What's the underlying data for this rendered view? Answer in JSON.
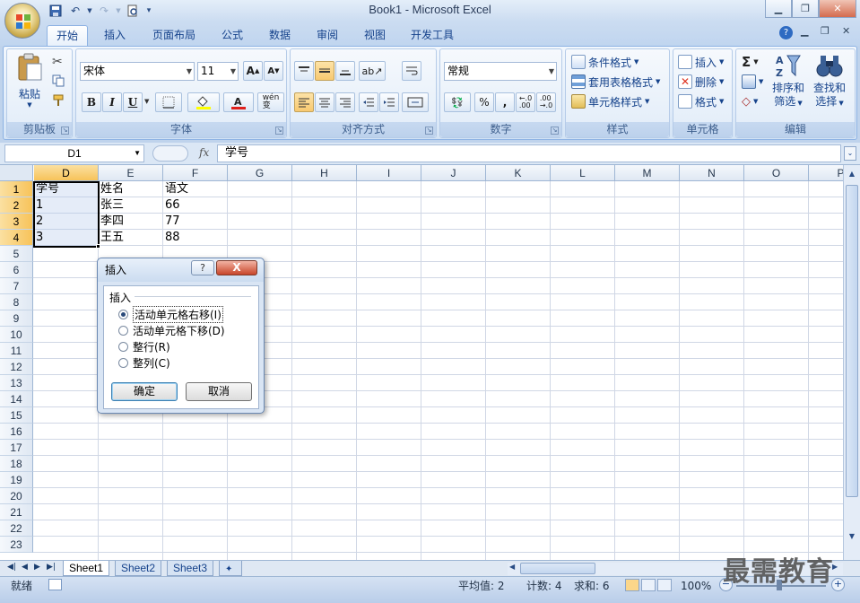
{
  "window": {
    "title": "Book1 - Microsoft Excel"
  },
  "tabs": [
    "开始",
    "插入",
    "页面布局",
    "公式",
    "数据",
    "审阅",
    "视图",
    "开发工具"
  ],
  "ribbon": {
    "clipboard": {
      "label": "剪贴板",
      "paste": "粘贴"
    },
    "font": {
      "label": "字体",
      "name": "宋体",
      "size": "11",
      "bold": "B",
      "italic": "I",
      "underline": "U",
      "phonetic": "wén\n变"
    },
    "alignment": {
      "label": "对齐方式"
    },
    "number": {
      "label": "数字",
      "format": "常规",
      "percent": "%",
      "comma": ",",
      "inc": "+.0 .00",
      "dec": ".00 +.0"
    },
    "styles": {
      "label": "样式",
      "conditional": "条件格式",
      "table": "套用表格格式",
      "cell": "单元格样式"
    },
    "cells": {
      "label": "单元格",
      "insert": "插入",
      "delete": "删除",
      "format": "格式"
    },
    "editing": {
      "label": "编辑",
      "sum": "Σ",
      "sort_line1": "排序和",
      "sort_line2": "筛选",
      "find_line1": "查找和",
      "find_line2": "选择"
    }
  },
  "formula_bar": {
    "name_box": "D1",
    "fx": "fx",
    "content": "学号"
  },
  "columns": [
    "D",
    "E",
    "F",
    "G",
    "H",
    "I",
    "J",
    "K",
    "L",
    "M",
    "N",
    "O",
    "P"
  ],
  "rows": [
    "1",
    "2",
    "3",
    "4",
    "5",
    "6",
    "7",
    "8",
    "9",
    "10",
    "11",
    "12",
    "13",
    "14",
    "15",
    "16",
    "17",
    "18",
    "19",
    "20",
    "21",
    "22",
    "23"
  ],
  "cells": [
    {
      "ref": "D1",
      "value": "学号"
    },
    {
      "ref": "E1",
      "value": "姓名"
    },
    {
      "ref": "F1",
      "value": "语文"
    },
    {
      "ref": "D2",
      "value": "1"
    },
    {
      "ref": "E2",
      "value": "张三"
    },
    {
      "ref": "F2",
      "value": "66"
    },
    {
      "ref": "D3",
      "value": "2"
    },
    {
      "ref": "E3",
      "value": "李四"
    },
    {
      "ref": "F3",
      "value": "77"
    },
    {
      "ref": "D4",
      "value": "3"
    },
    {
      "ref": "E4",
      "value": "王五"
    },
    {
      "ref": "F4",
      "value": "88"
    }
  ],
  "dialog": {
    "title": "插入",
    "help": "?",
    "close": "X",
    "group_label": "插入",
    "options": [
      "活动单元格右移(I)",
      "活动单元格下移(D)",
      "整行(R)",
      "整列(C)"
    ],
    "selected_index": 0,
    "ok": "确定",
    "cancel": "取消"
  },
  "sheets": [
    "Sheet1",
    "Sheet2",
    "Sheet3"
  ],
  "active_sheet": "Sheet1",
  "status": {
    "ready": "就绪",
    "average": "平均值: 2",
    "count": "计数: 4",
    "sum": "求和: 6",
    "zoom": "100%"
  },
  "watermark": "最需教育",
  "colors": {
    "accent": "#15428b",
    "selected_header": "#f7c35a",
    "ribbon_bg": "#dfebf9"
  }
}
